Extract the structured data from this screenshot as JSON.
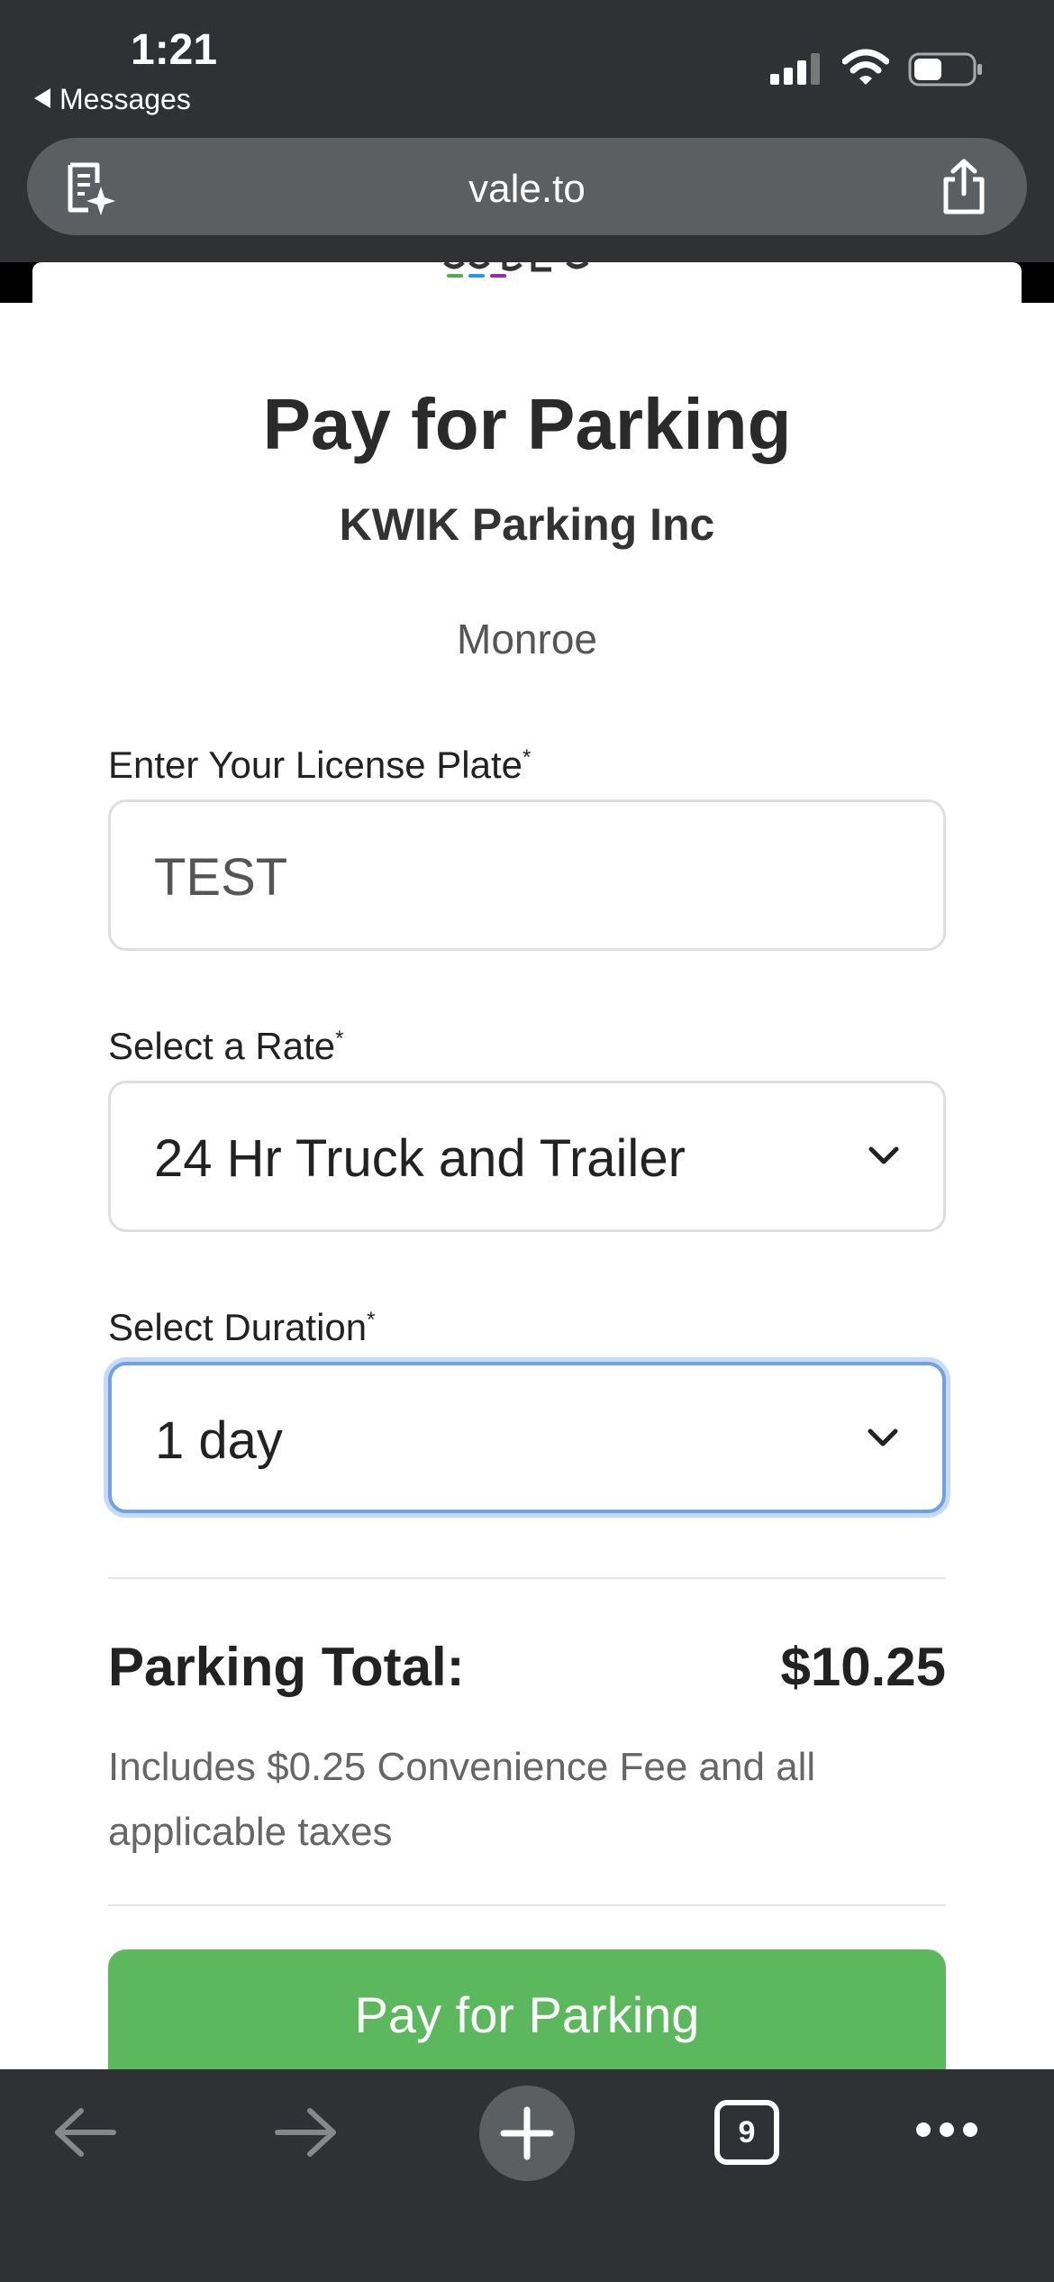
{
  "status_bar": {
    "time": "1:21",
    "back_app": "Messages"
  },
  "browser": {
    "url": "vale.to",
    "open_tabs": "9"
  },
  "page": {
    "title": "Pay for Parking",
    "company": "KWIK Parking Inc",
    "location": "Monroe",
    "plate": {
      "label": "Enter Your License Plate",
      "required_mark": "*",
      "value": "TEST"
    },
    "rate": {
      "label": "Select a Rate",
      "required_mark": "*",
      "selected": "24 Hr Truck and Trailer"
    },
    "duration": {
      "label": "Select Duration",
      "required_mark": "*",
      "selected": "1 day"
    },
    "total": {
      "label": "Parking Total:",
      "value": "$10.25",
      "note": "Includes $0.25 Convenience Fee and all applicable taxes"
    },
    "pay_button": "Pay for Parking"
  },
  "colors": {
    "pay_button": "#5cb85c",
    "focus_ring": "#6fa0e8",
    "browser_chrome": "#2f3134"
  },
  "icons": {
    "url_left": "reader-summary-icon",
    "share": "share-icon",
    "back": "back-arrow-icon",
    "forward": "forward-arrow-icon",
    "new_tab": "plus-icon",
    "tabs": "tabs-icon",
    "more": "more-icon"
  }
}
